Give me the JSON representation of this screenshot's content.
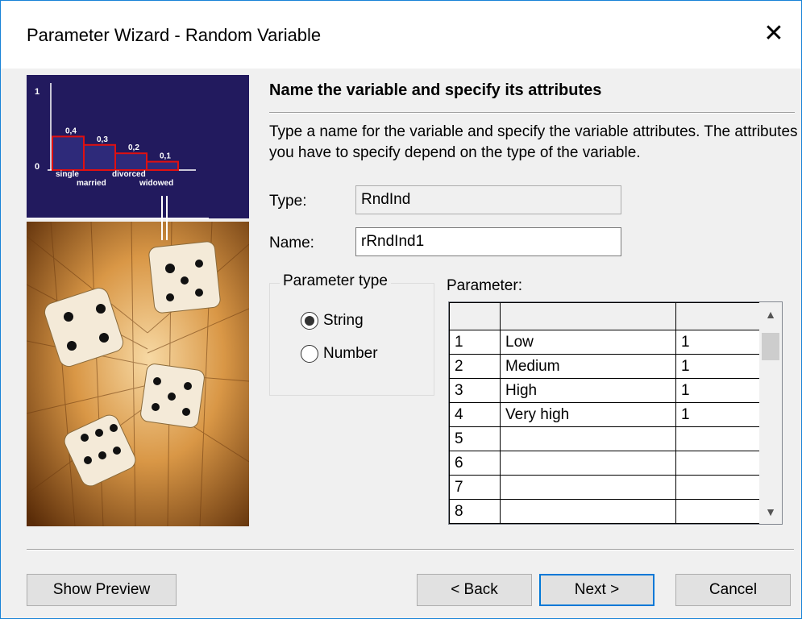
{
  "window": {
    "title": "Parameter Wizard - Random Variable",
    "close_glyph": "✕"
  },
  "illustration": {
    "chart_data": {
      "type": "bar",
      "categories": [
        "single",
        "married",
        "divorced",
        "widowed"
      ],
      "values": [
        0.4,
        0.3,
        0.2,
        0.1
      ],
      "value_labels": [
        "0,4",
        "0,3",
        "0,2",
        "0,1"
      ],
      "y_ticks": [
        "1",
        "0"
      ],
      "ylim": [
        0,
        1
      ]
    }
  },
  "main": {
    "heading": "Name the variable and specify its attributes",
    "description": "Type a name for the variable and specify the variable attributes. The attributes you have to specify depend on the type of the variable.",
    "type_label": "Type:",
    "type_value": "RndInd",
    "name_label": "Name:",
    "name_value": "rRndInd1",
    "param_type_label": "Parameter type",
    "radio_string": "String",
    "radio_number": "Number",
    "selected_param_type": "String",
    "parameter_label": "Parameter:",
    "grid": {
      "rows": [
        [
          "1",
          "Low",
          "1"
        ],
        [
          "2",
          "Medium",
          "1"
        ],
        [
          "3",
          "High",
          "1"
        ],
        [
          "4",
          "Very high",
          "1"
        ],
        [
          "5",
          "",
          ""
        ],
        [
          "6",
          "",
          ""
        ],
        [
          "7",
          "",
          ""
        ],
        [
          "8",
          "",
          ""
        ]
      ]
    }
  },
  "footer": {
    "show_preview": "Show Preview",
    "back": "< Back",
    "next": "Next >",
    "cancel": "Cancel"
  },
  "colors": {
    "accent": "#0078d7",
    "art_bg": "#221a5e",
    "bar_outline": "#e01010"
  }
}
